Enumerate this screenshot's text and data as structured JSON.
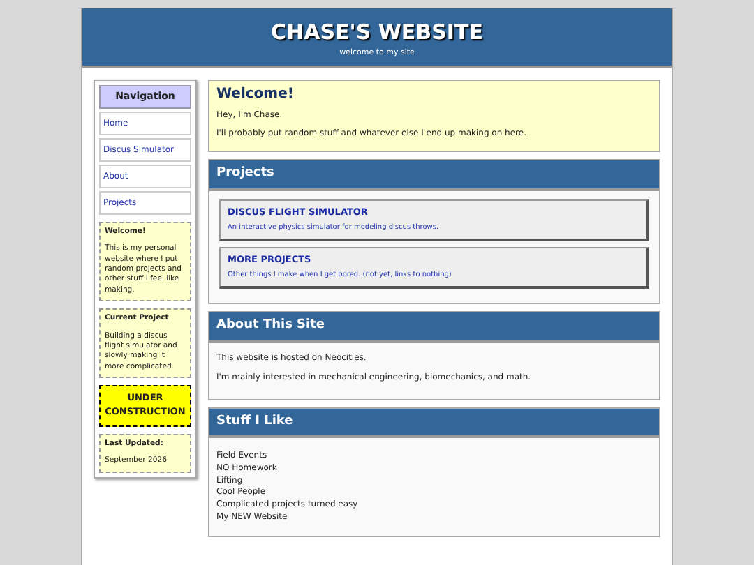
{
  "header": {
    "title": "CHASE'S WEBSITE",
    "subtitle": "welcome to my site"
  },
  "sidebar": {
    "heading": "Navigation",
    "links": [
      {
        "label": "Home"
      },
      {
        "label": "Discus Simulator"
      },
      {
        "label": "About"
      },
      {
        "label": "Projects"
      }
    ],
    "boxes": [
      {
        "kind": "note",
        "title": "Welcome!",
        "text": "This is my personal website where I put random projects and other stuff I feel like making."
      },
      {
        "kind": "note",
        "title": "Current Project",
        "text": "Building a discus flight simulator and slowly making it more complicated."
      },
      {
        "kind": "alert",
        "title": "UNDER CONSTRUCTION"
      },
      {
        "kind": "note",
        "title": "Last Updated:",
        "text": "September 2026"
      }
    ]
  },
  "welcome": {
    "title": "Welcome!",
    "paragraphs": [
      "Hey, I'm Chase.",
      "I'll probably put random stuff and whatever else I end up making on here."
    ]
  },
  "sections": [
    {
      "kind": "projects",
      "title": "Projects",
      "items": [
        {
          "title": "DISCUS FLIGHT SIMULATOR",
          "description": "An interactive physics simulator for modeling discus throws."
        },
        {
          "title": "MORE PROJECTS",
          "description": "Other things I make when I get bored. (not yet, links to nothing)"
        }
      ]
    },
    {
      "kind": "text",
      "title": "About This Site",
      "paragraphs": [
        "This website is hosted on Neocities.",
        "I'm mainly interested in mechanical engineering, biomechanics, and math."
      ]
    },
    {
      "kind": "list",
      "title": "Stuff I Like",
      "items": [
        "Field Events",
        "NO Homework",
        "Lifting",
        "Cool People",
        "Complicated projects turned easy",
        "My NEW Website"
      ]
    }
  ]
}
